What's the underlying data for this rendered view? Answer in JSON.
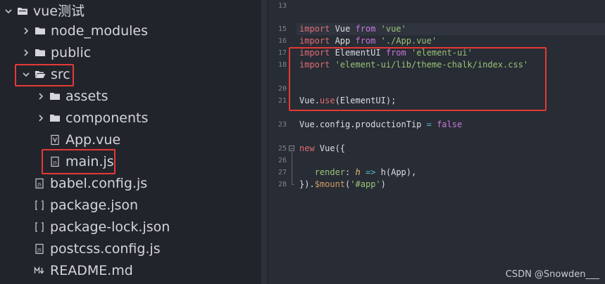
{
  "sidebar": {
    "items": [
      {
        "label": "vue测试",
        "kind": "folder-root",
        "icon": "folder-icon"
      },
      {
        "label": "node_modules",
        "kind": "folder",
        "icon": "folder-icon"
      },
      {
        "label": "public",
        "kind": "folder",
        "icon": "folder-icon"
      },
      {
        "label": "src",
        "kind": "folder-open",
        "icon": "folder-open-icon"
      },
      {
        "label": "assets",
        "kind": "folder",
        "icon": "folder-icon"
      },
      {
        "label": "components",
        "kind": "folder",
        "icon": "folder-icon"
      },
      {
        "label": "App.vue",
        "kind": "file",
        "icon": "vue-file-icon"
      },
      {
        "label": "main.js",
        "kind": "file",
        "icon": "js-file-icon"
      },
      {
        "label": "babel.config.js",
        "kind": "file",
        "icon": "js-file-icon"
      },
      {
        "label": "package.json",
        "kind": "file",
        "icon": "json-file-icon"
      },
      {
        "label": "package-lock.json",
        "kind": "file",
        "icon": "json-file-icon"
      },
      {
        "label": "postcss.config.js",
        "kind": "file",
        "icon": "js-file-icon"
      },
      {
        "label": "README.md",
        "kind": "file",
        "icon": "markdown-file-icon"
      }
    ]
  },
  "editor": {
    "line_numbers": [
      "13",
      "15",
      "16",
      "17",
      "18",
      "20",
      "21",
      "23",
      "25",
      "26",
      "27",
      "28"
    ],
    "code": {
      "l15": {
        "kw": "import",
        "a": " Vue ",
        "from": "from",
        "str": "'vue'"
      },
      "l16": {
        "kw": "import",
        "a": " App ",
        "from": "from",
        "str": "'./App.vue'"
      },
      "l17": {
        "kw": "import",
        "a": " ElementUI ",
        "from": "from",
        "str": "'element-ui'"
      },
      "l18": {
        "kw": "import",
        "str": "'element-ui/lib/theme-chalk/index.css'"
      },
      "l21": {
        "obj": "Vue",
        "dot": ".",
        "fn": "use",
        "rest": "(ElementUI);"
      },
      "l23": {
        "a": "Vue.config.productionTip",
        "op": " = ",
        "val": "false"
      },
      "l25": {
        "kw": "new",
        "a": " Vue({"
      },
      "l27": {
        "key": "render",
        "colon": ": ",
        "param": "h",
        "arrow": " => ",
        "fn": "h",
        "rest": "(App),"
      },
      "l28": {
        "a": "}).",
        "fn": "$mount",
        "open": "(",
        "str": "'#app'",
        "close": ")"
      }
    }
  },
  "watermark": "CSDN @Snowden___",
  "colors": {
    "sidebar_bg": "#21252b",
    "editor_bg": "#282c34",
    "keyword": "#c678dd",
    "string": "#98c379",
    "function": "#61afef",
    "annotation": "#e53935"
  }
}
